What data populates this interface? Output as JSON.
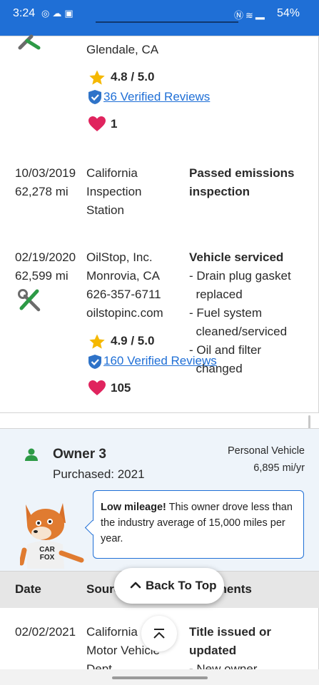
{
  "status_bar": {
    "time": "3:24",
    "left_icons": [
      "signal-app-icon",
      "cloud-icon",
      "image-icon"
    ],
    "right_icons": [
      "nfc-icon",
      "wifi-icon",
      "cell-signal-icon"
    ],
    "battery": "54%",
    "accent_color": "#1f6fd6"
  },
  "record_top": {
    "location": "Glendale, CA",
    "rating": "4.8 / 5.0",
    "reviews_link": "36 Verified Reviews",
    "favorites": "1"
  },
  "record_inspection": {
    "date": "10/03/2019",
    "mileage": "62,278 mi",
    "source_lines": [
      "California",
      "Inspection",
      "Station"
    ],
    "comment_lines": [
      "Passed emissions",
      "inspection"
    ]
  },
  "record_service": {
    "date": "02/19/2020",
    "mileage": "62,599 mi",
    "source_name": "OilStop, Inc.",
    "source_city": "Monrovia, CA",
    "source_phone": "626-357-6711",
    "source_web": "oilstopinc.com",
    "rating": "4.9 / 5.0",
    "reviews_link": "160 Verified Reviews",
    "favorites": "105",
    "comment_title": "Vehicle serviced",
    "items": [
      [
        "- Drain plug gasket",
        "  replaced"
      ],
      [
        "- Fuel system",
        "  cleaned/serviced"
      ],
      [
        "- Oil and filter",
        "  changed"
      ]
    ]
  },
  "owner3": {
    "title": "Owner 3",
    "purchased": "Purchased: 2021",
    "usage_type": "Personal Vehicle",
    "usage_rate": "6,895 mi/yr",
    "bubble_bold": "Low mileage!",
    "bubble_text": " This owner drove less than the industry average of 15,000 miles per year.",
    "mascot_shirt": "CAR FOX"
  },
  "table_header": {
    "date": "Date",
    "source": "Source",
    "comments": "Comments"
  },
  "back_to_top": "Back To Top",
  "record_title": {
    "date": "02/02/2021",
    "source_lines": [
      "California",
      "Motor Vehicle",
      "Dept."
    ],
    "comment_lines": [
      "Title issued or",
      "updated",
      "- New owner"
    ]
  }
}
